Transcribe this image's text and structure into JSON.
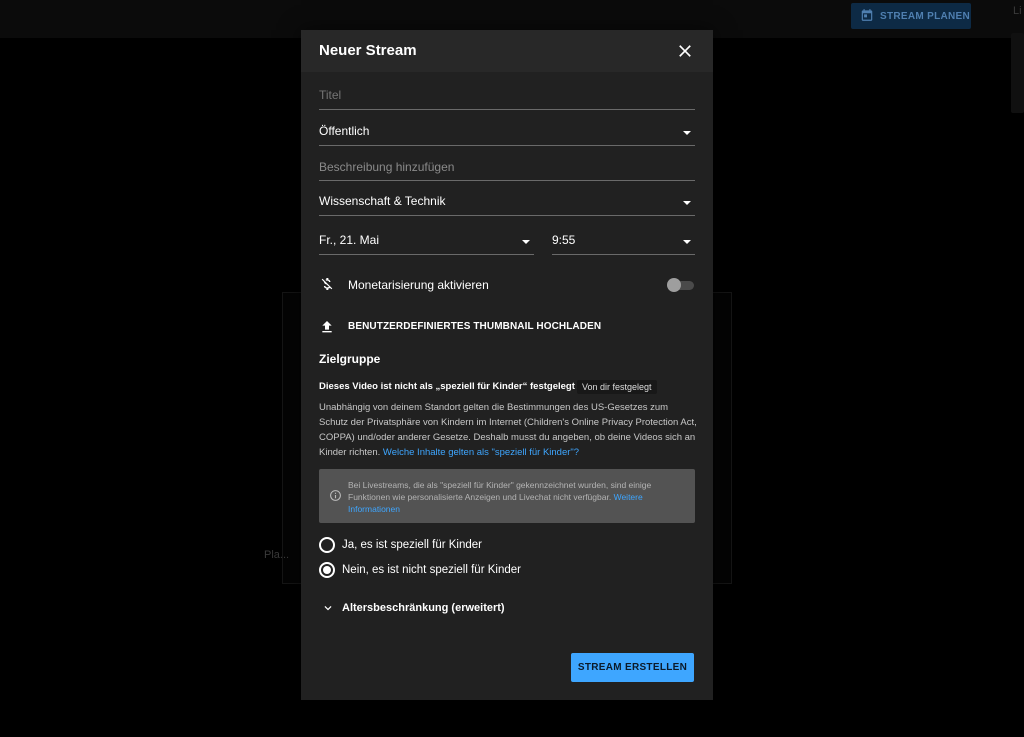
{
  "background": {
    "plan_button_label": "STREAM PLANEN",
    "right_label": "Li",
    "card_label": "Pla..."
  },
  "dialog": {
    "title": "Neuer Stream",
    "title_field": {
      "placeholder": "Titel",
      "value": ""
    },
    "visibility": {
      "value": "Öffentlich"
    },
    "description_field": {
      "placeholder": "Beschreibung hinzufügen"
    },
    "category": {
      "value": "Wissenschaft & Technik"
    },
    "date": {
      "value": "Fr., 21. Mai"
    },
    "time": {
      "value": "9:55"
    },
    "monetization": {
      "label": "Monetarisierung aktivieren",
      "enabled": false
    },
    "thumbnail_upload_label": "BENUTZERDEFINIERTES THUMBNAIL HOCHLADEN",
    "audience": {
      "title": "Zielgruppe",
      "status": "Dieses Video ist nicht als „speziell für Kinder“ festgelegt",
      "badge": "Von dir festgelegt",
      "description": "Unabhängig von deinem Standort gelten die Bestimmungen des US-Gesetzes zum Schutz der Privatsphäre von Kindern im Internet (Children's Online Privacy Protection Act, COPPA) und/oder anderer Gesetze. Deshalb musst du angeben, ob deine Videos sich an Kinder richten.",
      "description_link": "Welche Inhalte gelten als \"speziell für Kinder\"?",
      "info_text": "Bei Livestreams, die als \"speziell für Kinder\" gekennzeichnet wurden, sind einige Funktionen wie personalisierte Anzeigen und Livechat nicht verfügbar.",
      "info_link": "Weitere Informationen",
      "option_yes": "Ja, es ist speziell für Kinder",
      "option_no": "Nein, es ist nicht speziell für Kinder",
      "selected": "no"
    },
    "age_restriction_label": "Altersbeschränkung (erweitert)",
    "create_button_label": "STREAM ERSTELLEN"
  },
  "colors": {
    "accent": "#3ea6ff",
    "dialog_bg": "#212121",
    "header_bg": "#282828",
    "info_box_bg": "#535353"
  },
  "icons": [
    "calendar-icon",
    "close-icon",
    "monetization-off-icon",
    "upload-icon",
    "info-icon",
    "chevron-down-icon"
  ]
}
